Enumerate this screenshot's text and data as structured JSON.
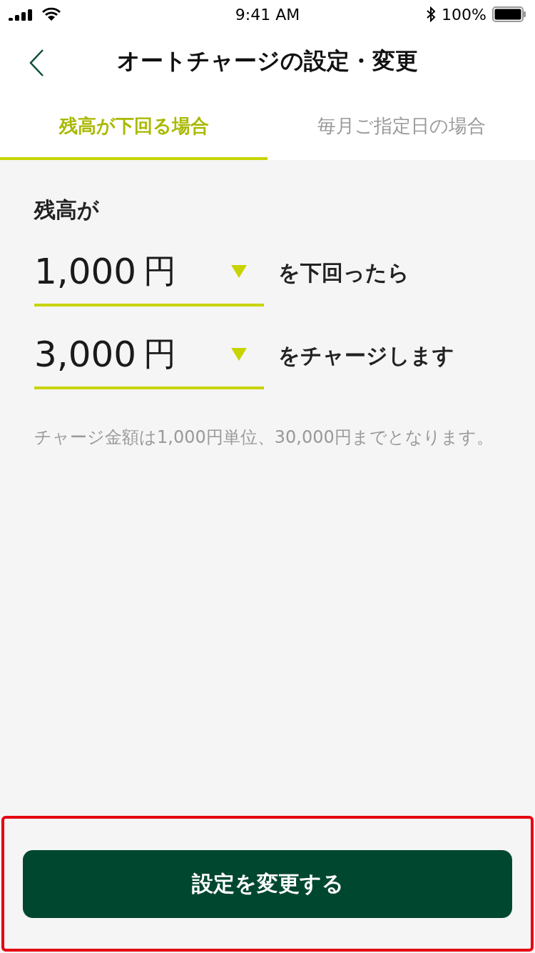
{
  "status_bar": {
    "time": "9:41 AM",
    "battery": "100%"
  },
  "header": {
    "title": "オートチャージの設定・変更"
  },
  "tabs": [
    {
      "label": "残高が下回る場合",
      "selected": true
    },
    {
      "label": "毎月ご指定日の場合",
      "selected": false
    }
  ],
  "form": {
    "label": "残高が",
    "rows": [
      {
        "amount": "1,000",
        "unit": "円",
        "suffix": "を下回ったら"
      },
      {
        "amount": "3,000",
        "unit": "円",
        "suffix": "をチャージします"
      }
    ],
    "note": "チャージ金額は1,000円単位、30,000円までとなります。"
  },
  "submit_button": "設定を変更する"
}
